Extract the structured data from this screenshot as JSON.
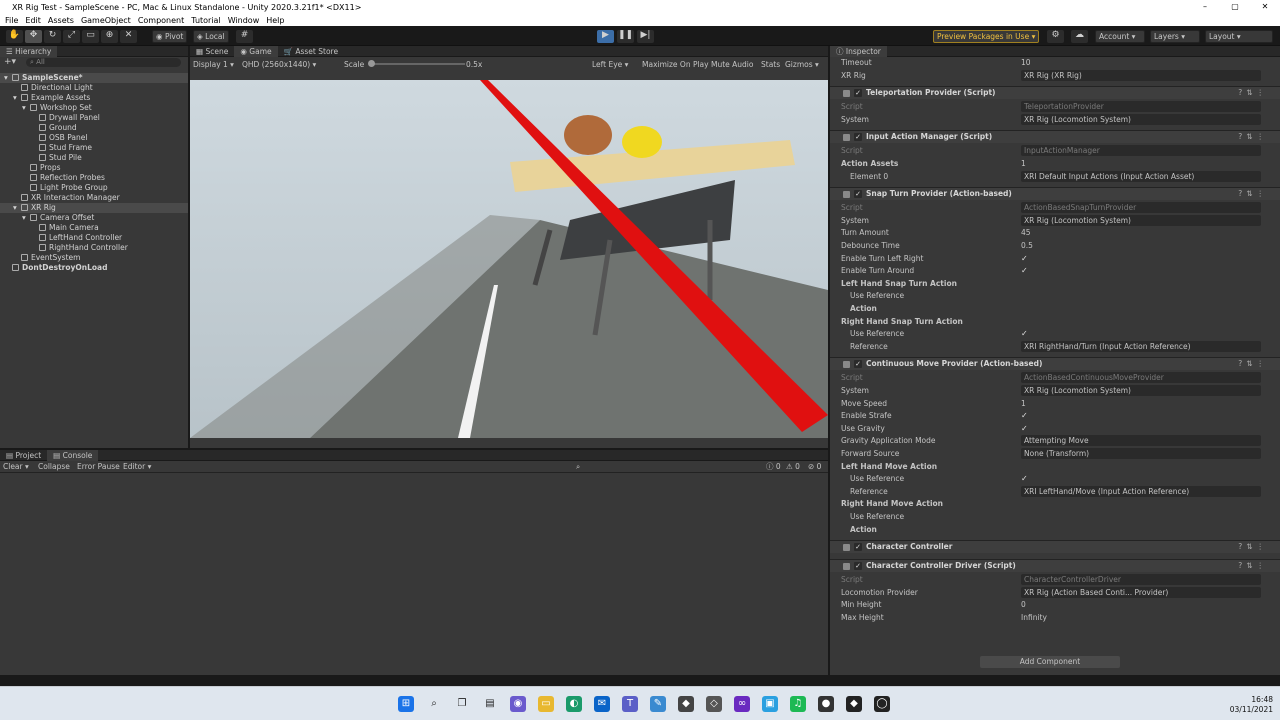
{
  "window": {
    "title": "XR Rig Test - SampleScene - PC, Mac & Linux Standalone - Unity 2020.3.21f1* <DX11>",
    "minimize": "–",
    "maximize": "▢",
    "close": "✕"
  },
  "menu": [
    "File",
    "Edit",
    "Assets",
    "GameObject",
    "Component",
    "Tutorial",
    "Window",
    "Help"
  ],
  "toolbar": {
    "pivot": "Pivot",
    "local": "Local",
    "preview_packages": "Preview Packages in Use ▾",
    "account": "Account ▾",
    "layers": "Layers ▾",
    "layout": "Layout ▾"
  },
  "hierarchy": {
    "tab": "Hierarchy",
    "search": "All",
    "items": [
      {
        "label": "SampleScene*",
        "depth": 0
      },
      {
        "label": "Directional Light",
        "depth": 1
      },
      {
        "label": "Example Assets",
        "depth": 1
      },
      {
        "label": "Workshop Set",
        "depth": 2
      },
      {
        "label": "Drywall Panel",
        "depth": 3
      },
      {
        "label": "Ground",
        "depth": 3
      },
      {
        "label": "OSB Panel",
        "depth": 3
      },
      {
        "label": "Stud Frame",
        "depth": 3
      },
      {
        "label": "Stud Pile",
        "depth": 3
      },
      {
        "label": "Props",
        "depth": 2
      },
      {
        "label": "Reflection Probes",
        "depth": 2
      },
      {
        "label": "Light Probe Group",
        "depth": 2
      },
      {
        "label": "XR Interaction Manager",
        "depth": 1
      },
      {
        "label": "XR Rig",
        "depth": 1
      },
      {
        "label": "Camera Offset",
        "depth": 2
      },
      {
        "label": "Main Camera",
        "depth": 3
      },
      {
        "label": "LeftHand Controller",
        "depth": 3
      },
      {
        "label": "RightHand Controller",
        "depth": 3
      },
      {
        "label": "EventSystem",
        "depth": 1
      },
      {
        "label": "DontDestroyOnLoad",
        "depth": 0
      }
    ]
  },
  "game": {
    "tabs": [
      "Scene",
      "Game",
      "Asset Store"
    ],
    "display": "Display 1 ▾",
    "resolution": "QHD (2560x1440) ▾",
    "scale_label": "Scale",
    "scale_value": "0.5x",
    "eye": "Left Eye ▾",
    "maximize": "Maximize On Play",
    "mute": "Mute Audio",
    "stats": "Stats",
    "gizmos": "Gizmos ▾"
  },
  "console": {
    "tabs": [
      "Project",
      "Console"
    ],
    "clear": "Clear ▾",
    "collapse": "Collapse",
    "error_pause": "Error Pause",
    "editor": "Editor ▾",
    "counts": [
      "0",
      "0",
      "0"
    ]
  },
  "inspector": {
    "tab": "Inspector",
    "add_component": "Add Component",
    "rows": [
      {
        "type": "row",
        "label": "Timeout",
        "value": "10",
        "style": "plain"
      },
      {
        "type": "row",
        "label": "XR Rig",
        "value": "XR Rig (XR Rig)",
        "style": "field"
      },
      {
        "type": "comp",
        "label": "Teleportation Provider (Script)"
      },
      {
        "type": "row",
        "label": "Script",
        "value": "TeleportationProvider",
        "style": "dimfield"
      },
      {
        "type": "row",
        "label": "System",
        "value": "XR Rig (Locomotion System)",
        "style": "field"
      },
      {
        "type": "comp",
        "label": "Input Action Manager (Script)"
      },
      {
        "type": "row",
        "label": "Script",
        "value": "InputActionManager",
        "style": "dimfield"
      },
      {
        "type": "row",
        "label": "Action Assets",
        "value": "1",
        "style": "plain",
        "bold": true
      },
      {
        "type": "row",
        "label": "Element 0",
        "value": "XRI Default Input Actions (Input Action Asset)",
        "style": "field",
        "indent": true
      },
      {
        "type": "comp",
        "label": "Snap Turn Provider (Action-based)"
      },
      {
        "type": "row",
        "label": "Script",
        "value": "ActionBasedSnapTurnProvider",
        "style": "dimfield"
      },
      {
        "type": "row",
        "label": "System",
        "value": "XR Rig (Locomotion System)",
        "style": "field"
      },
      {
        "type": "row",
        "label": "Turn Amount",
        "value": "45",
        "style": "plain"
      },
      {
        "type": "row",
        "label": "Debounce Time",
        "value": "0.5",
        "style": "plain"
      },
      {
        "type": "row",
        "label": "Enable Turn Left Right",
        "value": "✓",
        "style": "check"
      },
      {
        "type": "row",
        "label": "Enable Turn Around",
        "value": "✓",
        "style": "check"
      },
      {
        "type": "row",
        "label": "Left Hand Snap Turn Action",
        "value": "",
        "style": "plain",
        "bold": true
      },
      {
        "type": "row",
        "label": "Use Reference",
        "value": "",
        "style": "check",
        "indent": true
      },
      {
        "type": "row",
        "label": "Action",
        "value": "",
        "style": "plain",
        "indent": true,
        "bold": true
      },
      {
        "type": "row",
        "label": "Right Hand Snap Turn Action",
        "value": "",
        "style": "plain",
        "bold": true
      },
      {
        "type": "row",
        "label": "Use Reference",
        "value": "✓",
        "style": "check",
        "indent": true
      },
      {
        "type": "row",
        "label": "Reference",
        "value": "XRI RightHand/Turn (Input Action Reference)",
        "style": "field",
        "indent": true
      },
      {
        "type": "comp",
        "label": "Continuous Move Provider (Action-based)"
      },
      {
        "type": "row",
        "label": "Script",
        "value": "ActionBasedContinuousMoveProvider",
        "style": "dimfield"
      },
      {
        "type": "row",
        "label": "System",
        "value": "XR Rig (Locomotion System)",
        "style": "field"
      },
      {
        "type": "row",
        "label": "Move Speed",
        "value": "1",
        "style": "plain"
      },
      {
        "type": "row",
        "label": "Enable Strafe",
        "value": "✓",
        "style": "check"
      },
      {
        "type": "row",
        "label": "Use Gravity",
        "value": "✓",
        "style": "check"
      },
      {
        "type": "row",
        "label": "Gravity Application Mode",
        "value": "Attempting Move",
        "style": "field"
      },
      {
        "type": "row",
        "label": "Forward Source",
        "value": "None (Transform)",
        "style": "field"
      },
      {
        "type": "row",
        "label": "Left Hand Move Action",
        "value": "",
        "style": "plain",
        "bold": true
      },
      {
        "type": "row",
        "label": "Use Reference",
        "value": "✓",
        "style": "check",
        "indent": true
      },
      {
        "type": "row",
        "label": "Reference",
        "value": "XRI LeftHand/Move (Input Action Reference)",
        "style": "field",
        "indent": true
      },
      {
        "type": "row",
        "label": "Right Hand Move Action",
        "value": "",
        "style": "plain",
        "bold": true
      },
      {
        "type": "row",
        "label": "Use Reference",
        "value": "",
        "style": "check",
        "indent": true
      },
      {
        "type": "row",
        "label": "Action",
        "value": "",
        "style": "plain",
        "indent": true,
        "bold": true
      },
      {
        "type": "comp",
        "label": "Character Controller"
      },
      {
        "type": "comp",
        "label": "Character Controller Driver (Script)"
      },
      {
        "type": "row",
        "label": "Script",
        "value": "CharacterControllerDriver",
        "style": "dimfield"
      },
      {
        "type": "row",
        "label": "Locomotion Provider",
        "value": "XR Rig (Action Based Conti... Provider)",
        "style": "field"
      },
      {
        "type": "row",
        "label": "Min Height",
        "value": "0",
        "style": "plain"
      },
      {
        "type": "row",
        "label": "Max Height",
        "value": "Infinity",
        "style": "plain"
      }
    ]
  },
  "taskbar": {
    "time": "16:48",
    "date": "03/11/2021"
  }
}
